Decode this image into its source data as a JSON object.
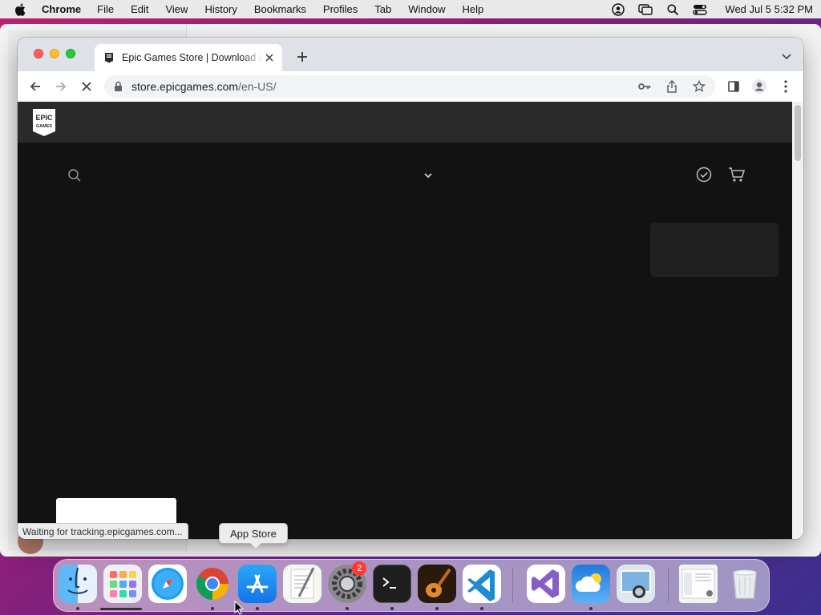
{
  "menubar": {
    "app_name": "Chrome",
    "items": [
      "File",
      "Edit",
      "View",
      "History",
      "Bookmarks",
      "Profiles",
      "Tab",
      "Window",
      "Help"
    ],
    "clock": "Wed Jul 5  5:32 PM"
  },
  "browser": {
    "tab_title": "Epic Games Store | Download & Play",
    "url_host": "store.epicgames.com",
    "url_path": "/en-US/",
    "status_text": "Waiting for tracking.epicgames.com..."
  },
  "page": {
    "logo_text": "EPIC GAMES"
  },
  "tooltip": {
    "label": "App Store"
  },
  "dock": {
    "items": [
      "finder-icon",
      "launchpad-icon",
      "safari-icon",
      "chrome-icon",
      "app-store-icon",
      "textedit-icon",
      "system-settings-icon",
      "terminal-icon",
      "garageband-icon",
      "vscode-icon",
      "visual-studio-icon",
      "weather-icon",
      "preview-icon",
      "downloads-stack-icon",
      "trash-icon"
    ],
    "settings_badge": "2"
  },
  "colors": {
    "page_bg": "#121212",
    "nav_bg": "#2a2a2a",
    "tab_bg": "#ffffff",
    "tabstrip_bg": "#dee1e6"
  }
}
